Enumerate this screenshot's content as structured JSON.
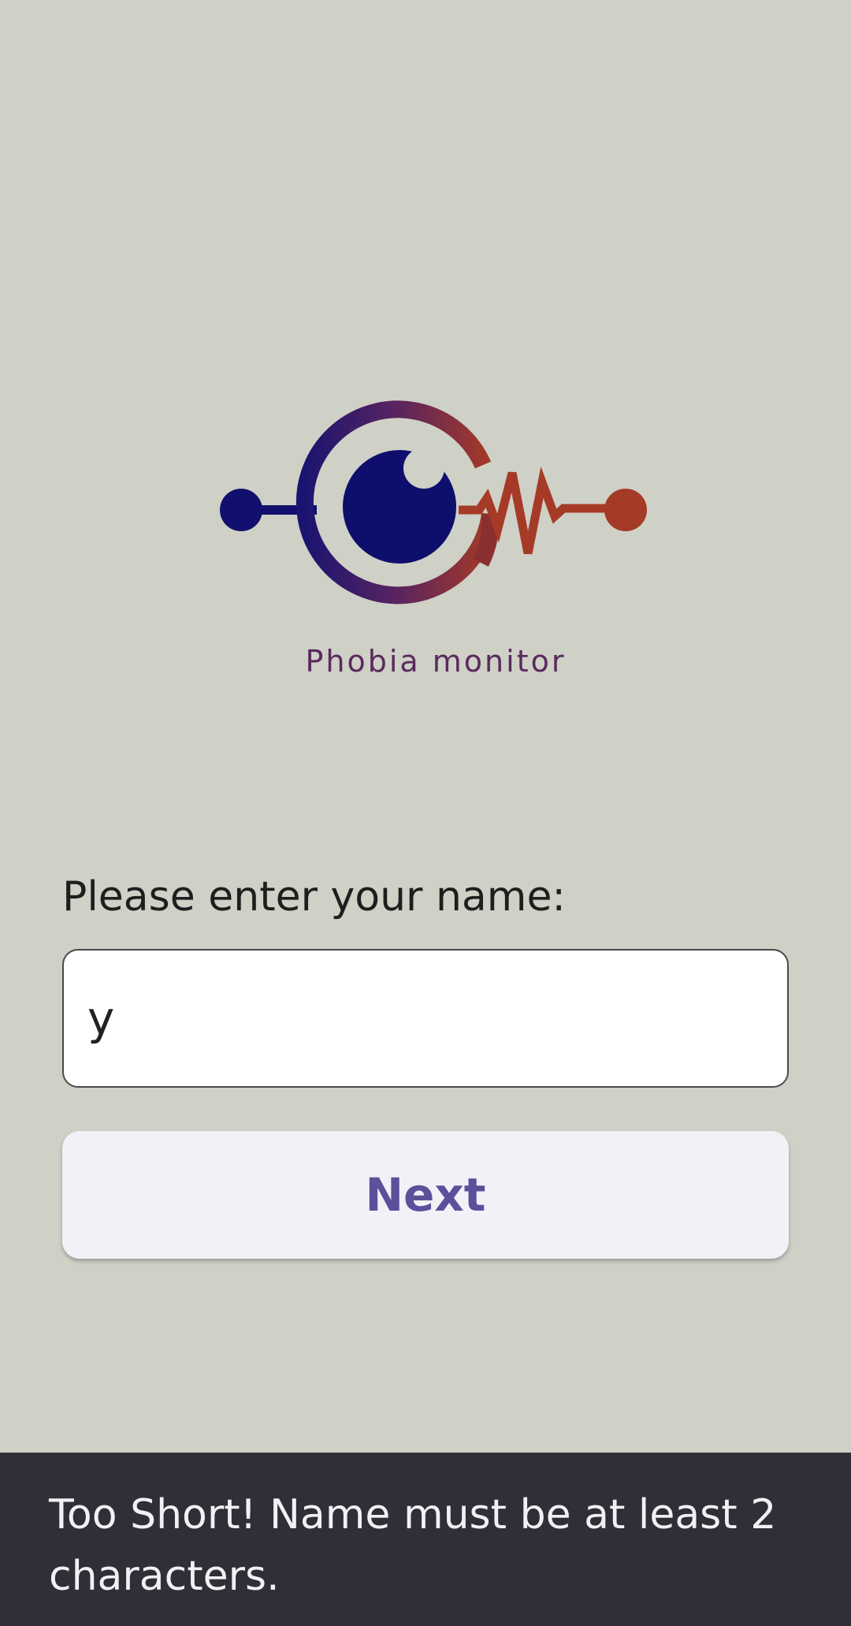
{
  "logo": {
    "wordmark": "Phobia monitor",
    "icon": "eye-heartbeat-logo-icon",
    "colors": {
      "navy": "#12106e",
      "rust": "#a53a26",
      "purple": "#4a2a7a"
    }
  },
  "form": {
    "label": "Please enter your name:",
    "name_value": "y",
    "next_label": "Next"
  },
  "snackbar": {
    "message": "Too Short! Name must be at least 2 characters."
  },
  "colors": {
    "background": "#cfd0c6",
    "button_text": "#5e4f9b",
    "button_bg": "#f3f1f8",
    "snackbar_bg": "#302e36"
  }
}
